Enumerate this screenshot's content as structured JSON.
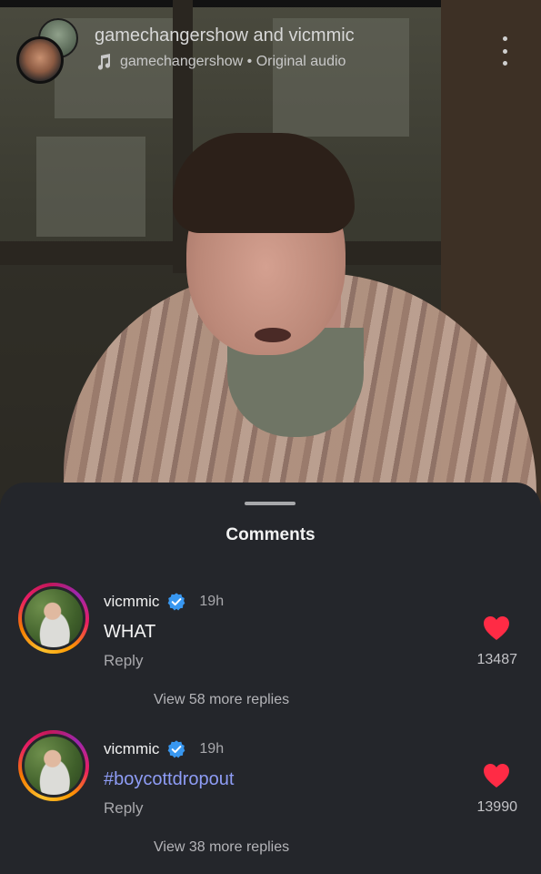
{
  "header": {
    "title": "gamechangershow and vicmmic",
    "subtitle": "gamechangershow • Original audio",
    "music_icon": "music-note-icon",
    "more_icon": "vertical-dots-icon"
  },
  "sheet": {
    "title": "Comments"
  },
  "comments": [
    {
      "username": "vicmmic",
      "verified": true,
      "time": "19h",
      "text": "WHAT",
      "reply_label": "Reply",
      "likes": "13487",
      "more_replies": "View 58 more replies"
    },
    {
      "username": "vicmmic",
      "verified": true,
      "time": "19h",
      "text": "#boycottdropout",
      "reply_label": "Reply",
      "likes": "13990",
      "more_replies": "View 38 more replies"
    }
  ],
  "colors": {
    "heart": "#ff2b45",
    "verified": "#3897f0",
    "hashtag": "#8e9cf5",
    "sheet_bg": "#24262b"
  }
}
